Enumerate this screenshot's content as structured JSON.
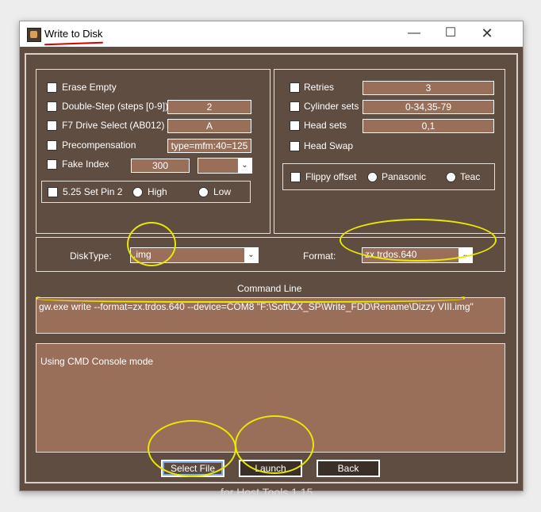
{
  "window": {
    "title": "Write to Disk",
    "controls": {
      "minimize": "—",
      "maximize": "☐",
      "close": "✕"
    }
  },
  "left_options": {
    "erase_empty": "Erase Empty",
    "double_step": "Double-Step (steps [0-9])",
    "double_step_value": "2",
    "f7_drive_select": "F7 Drive Select (AB012)",
    "f7_drive_value": "A",
    "precompensation": "Precompensation",
    "precompensation_value": "type=mfm:40=125",
    "fake_index": "Fake Index",
    "fake_index_value": "300",
    "fake_index_unit": "",
    "pin2_label": "5.25 Set Pin 2",
    "pin2_high": "High",
    "pin2_low": "Low"
  },
  "right_options": {
    "retries": "Retries",
    "retries_value": "3",
    "cylinder_sets": "Cylinder sets",
    "cylinder_sets_value": "0-34,35-79",
    "head_sets": "Head sets",
    "head_sets_value": "0,1",
    "head_swap": "Head Swap",
    "flippy_offset": "Flippy offset",
    "flippy_panasonic": "Panasonic",
    "flippy_teac": "Teac"
  },
  "disk_type": {
    "label": "DiskType:",
    "value": ".img"
  },
  "format": {
    "label": "Format:",
    "value": "zx.trdos.640"
  },
  "command_line": {
    "label": "Command Line",
    "value": "gw.exe write --format=zx.trdos.640 --device=COM8 \"F:\\Soft\\ZX_SP\\Write_FDD\\Rename\\Dizzy VIII.img\""
  },
  "console": {
    "text": "Using CMD Console mode"
  },
  "buttons": {
    "select_file": "Select File",
    "launch": "Launch",
    "back": "Back"
  },
  "footer": "for Host Tools 1.15",
  "colors": {
    "window_bg": "#5f4d42",
    "field_bg": "#9a6f59",
    "annotation": "#e8e800",
    "title_underline": "#d40000"
  }
}
